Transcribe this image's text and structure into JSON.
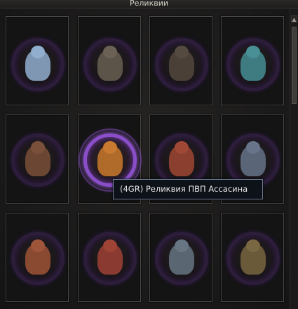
{
  "window": {
    "title": "Реликвии"
  },
  "tooltip": {
    "text": "(4GR) Реликвия ПВП Ассасина"
  },
  "slots": [
    {
      "icon": "ice-spirit-icon",
      "color": "#7f97b3"
    },
    {
      "icon": "armored-beast-icon",
      "color": "#5d5449"
    },
    {
      "icon": "hooded-warrior-icon",
      "color": "#4a4038"
    },
    {
      "icon": "dark-elf-icon",
      "color": "#3f7c82"
    },
    {
      "icon": "rock-golem-icon",
      "color": "#6b4632"
    },
    {
      "icon": "pvp-assassin-icon",
      "color": "#b06a2a"
    },
    {
      "icon": "red-spiked-beast-icon",
      "color": "#8a3f2f"
    },
    {
      "icon": "dark-portal-icon",
      "color": "#5a6578"
    },
    {
      "icon": "horned-dwarf-icon",
      "color": "#8a4a32"
    },
    {
      "icon": "red-demon-icon",
      "color": "#8a3a30"
    },
    {
      "icon": "steel-knight-icon",
      "color": "#5a6672"
    },
    {
      "icon": "orc-shaman-icon",
      "color": "#6a5a3a"
    }
  ]
}
